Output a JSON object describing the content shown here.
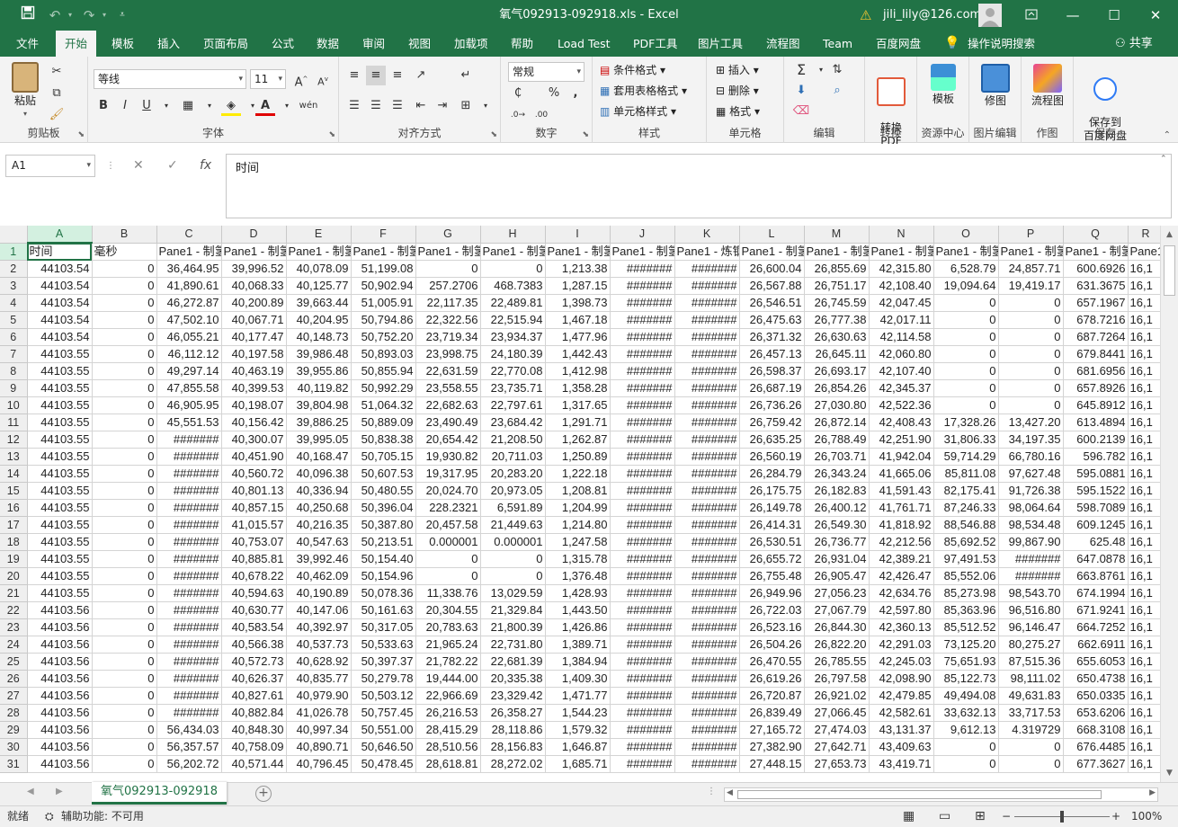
{
  "window": {
    "title": "氧气092913-092918.xls  -  Excel",
    "account": "jili_lily@126.com",
    "warning_icon": "warning-icon"
  },
  "qat": {
    "save": "save-icon",
    "undo": "undo-icon",
    "redo": "redo-icon",
    "customize": "customize-icon"
  },
  "tabs": [
    "文件",
    "开始",
    "模板",
    "插入",
    "页面布局",
    "公式",
    "数据",
    "审阅",
    "视图",
    "加载项",
    "帮助",
    "Load Test",
    "PDF工具",
    "图片工具",
    "流程图",
    "Team",
    "百度网盘"
  ],
  "active_tab": "开始",
  "tell_me": "操作说明搜索",
  "share": "共享",
  "ribbon": {
    "clipboard": {
      "label": "剪贴板",
      "paste": "粘贴"
    },
    "font": {
      "label": "字体",
      "name": "等线",
      "size": "11"
    },
    "align": {
      "label": "对齐方式"
    },
    "number": {
      "label": "数字",
      "format": "常规"
    },
    "styles": {
      "label": "样式",
      "conditional": "条件格式",
      "table": "套用表格格式",
      "cell": "单元格样式"
    },
    "cells": {
      "label": "单元格",
      "insert": "插入",
      "delete": "删除",
      "format": "格式"
    },
    "editing": {
      "label": "编辑"
    },
    "convert": {
      "label": "转换",
      "button": "转换\nPDF"
    },
    "resources": {
      "label": "资源中心",
      "button": "模板"
    },
    "image": {
      "label": "图片编辑",
      "button": "修图"
    },
    "draw": {
      "label": "作图",
      "button": "流程图"
    },
    "save": {
      "label": "保存",
      "button": "保存到\n百度网盘"
    }
  },
  "formula_bar": {
    "name_box": "A1",
    "content": "时间"
  },
  "grid": {
    "columns": [
      "A",
      "B",
      "C",
      "D",
      "E",
      "F",
      "G",
      "H",
      "I",
      "J",
      "K",
      "L",
      "M",
      "N",
      "O",
      "P",
      "Q",
      "R"
    ],
    "header_row": [
      "时间",
      "毫秒",
      "Pane1 - 制氢",
      "Pane1 - 制氢",
      "Pane1 - 制氢",
      "Pane1 - 制氢",
      "Pane1 - 制氢",
      "Pane1 - 制氢",
      "Pane1 - 制氢",
      "Pane1 - 制氢",
      "Pane1 - 炼钢",
      "Pane1 - 制氢",
      "Pane1 - 制氢",
      "Pane1 - 制氢",
      "Pane1 - 制氢",
      "Pane1 - 制氢",
      "Pane1 - 制氢",
      "Pane1"
    ],
    "rows": [
      [
        "44103.54",
        "0",
        "36,464.95",
        "39,996.52",
        "40,078.09",
        "51,199.08",
        "0",
        "0",
        "1,213.38",
        "#######",
        "#######",
        "26,600.04",
        "26,855.69",
        "42,315.80",
        "6,528.79",
        "24,857.71",
        "600.6926",
        "16,1"
      ],
      [
        "44103.54",
        "0",
        "41,890.61",
        "40,068.33",
        "40,125.77",
        "50,902.94",
        "257.2706",
        "468.7383",
        "1,287.15",
        "#######",
        "#######",
        "26,567.88",
        "26,751.17",
        "42,108.40",
        "19,094.64",
        "19,419.17",
        "631.3675",
        "16,1"
      ],
      [
        "44103.54",
        "0",
        "46,272.87",
        "40,200.89",
        "39,663.44",
        "51,005.91",
        "22,117.35",
        "22,489.81",
        "1,398.73",
        "#######",
        "#######",
        "26,546.51",
        "26,745.59",
        "42,047.45",
        "0",
        "0",
        "657.1967",
        "16,1"
      ],
      [
        "44103.54",
        "0",
        "47,502.10",
        "40,067.71",
        "40,204.95",
        "50,794.86",
        "22,322.56",
        "22,515.94",
        "1,467.18",
        "#######",
        "#######",
        "26,475.63",
        "26,777.38",
        "42,017.11",
        "0",
        "0",
        "678.7216",
        "16,1"
      ],
      [
        "44103.54",
        "0",
        "46,055.21",
        "40,177.47",
        "40,148.73",
        "50,752.20",
        "23,719.34",
        "23,934.37",
        "1,477.96",
        "#######",
        "#######",
        "26,371.32",
        "26,630.63",
        "42,114.58",
        "0",
        "0",
        "687.7264",
        "16,1"
      ],
      [
        "44103.55",
        "0",
        "46,112.12",
        "40,197.58",
        "39,986.48",
        "50,893.03",
        "23,998.75",
        "24,180.39",
        "1,442.43",
        "#######",
        "#######",
        "26,457.13",
        "26,645.11",
        "42,060.80",
        "0",
        "0",
        "679.8441",
        "16,1"
      ],
      [
        "44103.55",
        "0",
        "49,297.14",
        "40,463.19",
        "39,955.86",
        "50,855.94",
        "22,631.59",
        "22,770.08",
        "1,412.98",
        "#######",
        "#######",
        "26,598.37",
        "26,693.17",
        "42,107.40",
        "0",
        "0",
        "681.6956",
        "16,1"
      ],
      [
        "44103.55",
        "0",
        "47,855.58",
        "40,399.53",
        "40,119.82",
        "50,992.29",
        "23,558.55",
        "23,735.71",
        "1,358.28",
        "#######",
        "#######",
        "26,687.19",
        "26,854.26",
        "42,345.37",
        "0",
        "0",
        "657.8926",
        "16,1"
      ],
      [
        "44103.55",
        "0",
        "46,905.95",
        "40,198.07",
        "39,804.98",
        "51,064.32",
        "22,682.63",
        "22,797.61",
        "1,317.65",
        "#######",
        "#######",
        "26,736.26",
        "27,030.80",
        "42,522.36",
        "0",
        "0",
        "645.8912",
        "16,1"
      ],
      [
        "44103.55",
        "0",
        "45,551.53",
        "40,156.42",
        "39,886.25",
        "50,889.09",
        "23,490.49",
        "23,684.42",
        "1,291.71",
        "#######",
        "#######",
        "26,759.42",
        "26,872.14",
        "42,408.43",
        "17,328.26",
        "13,427.20",
        "613.4894",
        "16,1"
      ],
      [
        "44103.55",
        "0",
        "#######",
        "40,300.07",
        "39,995.05",
        "50,838.38",
        "20,654.42",
        "21,208.50",
        "1,262.87",
        "#######",
        "#######",
        "26,635.25",
        "26,788.49",
        "42,251.90",
        "31,806.33",
        "34,197.35",
        "600.2139",
        "16,1"
      ],
      [
        "44103.55",
        "0",
        "#######",
        "40,451.90",
        "40,168.47",
        "50,705.15",
        "19,930.82",
        "20,711.03",
        "1,250.89",
        "#######",
        "#######",
        "26,560.19",
        "26,703.71",
        "41,942.04",
        "59,714.29",
        "66,780.16",
        "596.782",
        "16,1"
      ],
      [
        "44103.55",
        "0",
        "#######",
        "40,560.72",
        "40,096.38",
        "50,607.53",
        "19,317.95",
        "20,283.20",
        "1,222.18",
        "#######",
        "#######",
        "26,284.79",
        "26,343.24",
        "41,665.06",
        "85,811.08",
        "97,627.48",
        "595.0881",
        "16,1"
      ],
      [
        "44103.55",
        "0",
        "#######",
        "40,801.13",
        "40,336.94",
        "50,480.55",
        "20,024.70",
        "20,973.05",
        "1,208.81",
        "#######",
        "#######",
        "26,175.75",
        "26,182.83",
        "41,591.43",
        "82,175.41",
        "91,726.38",
        "595.1522",
        "16,1"
      ],
      [
        "44103.55",
        "0",
        "#######",
        "40,857.15",
        "40,250.68",
        "50,396.04",
        "228.2321",
        "6,591.89",
        "1,204.99",
        "#######",
        "#######",
        "26,149.78",
        "26,400.12",
        "41,761.71",
        "87,246.33",
        "98,064.64",
        "598.7089",
        "16,1"
      ],
      [
        "44103.55",
        "0",
        "#######",
        "41,015.57",
        "40,216.35",
        "50,387.80",
        "20,457.58",
        "21,449.63",
        "1,214.80",
        "#######",
        "#######",
        "26,414.31",
        "26,549.30",
        "41,818.92",
        "88,546.88",
        "98,534.48",
        "609.1245",
        "16,1"
      ],
      [
        "44103.55",
        "0",
        "#######",
        "40,753.07",
        "40,547.63",
        "50,213.51",
        "0.000001",
        "0.000001",
        "1,247.58",
        "#######",
        "#######",
        "26,530.51",
        "26,736.77",
        "42,212.56",
        "85,692.52",
        "99,867.90",
        "625.48",
        "16,1"
      ],
      [
        "44103.55",
        "0",
        "#######",
        "40,885.81",
        "39,992.46",
        "50,154.40",
        "0",
        "0",
        "1,315.78",
        "#######",
        "#######",
        "26,655.72",
        "26,931.04",
        "42,389.21",
        "97,491.53",
        "#######",
        "647.0878",
        "16,1"
      ],
      [
        "44103.55",
        "0",
        "#######",
        "40,678.22",
        "40,462.09",
        "50,154.96",
        "0",
        "0",
        "1,376.48",
        "#######",
        "#######",
        "26,755.48",
        "26,905.47",
        "42,426.47",
        "85,552.06",
        "#######",
        "663.8761",
        "16,1"
      ],
      [
        "44103.55",
        "0",
        "#######",
        "40,594.63",
        "40,190.89",
        "50,078.36",
        "11,338.76",
        "13,029.59",
        "1,428.93",
        "#######",
        "#######",
        "26,949.96",
        "27,056.23",
        "42,634.76",
        "85,273.98",
        "98,543.70",
        "674.1994",
        "16,1"
      ],
      [
        "44103.56",
        "0",
        "#######",
        "40,630.77",
        "40,147.06",
        "50,161.63",
        "20,304.55",
        "21,329.84",
        "1,443.50",
        "#######",
        "#######",
        "26,722.03",
        "27,067.79",
        "42,597.80",
        "85,363.96",
        "96,516.80",
        "671.9241",
        "16,1"
      ],
      [
        "44103.56",
        "0",
        "#######",
        "40,583.54",
        "40,392.97",
        "50,317.05",
        "20,783.63",
        "21,800.39",
        "1,426.86",
        "#######",
        "#######",
        "26,523.16",
        "26,844.30",
        "42,360.13",
        "85,512.52",
        "96,146.47",
        "664.7252",
        "16,1"
      ],
      [
        "44103.56",
        "0",
        "#######",
        "40,566.38",
        "40,537.73",
        "50,533.63",
        "21,965.24",
        "22,731.80",
        "1,389.71",
        "#######",
        "#######",
        "26,504.26",
        "26,822.20",
        "42,291.03",
        "73,125.20",
        "80,275.27",
        "662.6911",
        "16,1"
      ],
      [
        "44103.56",
        "0",
        "#######",
        "40,572.73",
        "40,628.92",
        "50,397.37",
        "21,782.22",
        "22,681.39",
        "1,384.94",
        "#######",
        "#######",
        "26,470.55",
        "26,785.55",
        "42,245.03",
        "75,651.93",
        "87,515.36",
        "655.6053",
        "16,1"
      ],
      [
        "44103.56",
        "0",
        "#######",
        "40,626.37",
        "40,835.77",
        "50,279.78",
        "19,444.00",
        "20,335.38",
        "1,409.30",
        "#######",
        "#######",
        "26,619.26",
        "26,797.58",
        "42,098.90",
        "85,122.73",
        "98,111.02",
        "650.4738",
        "16,1"
      ],
      [
        "44103.56",
        "0",
        "#######",
        "40,827.61",
        "40,979.90",
        "50,503.12",
        "22,966.69",
        "23,329.42",
        "1,471.77",
        "#######",
        "#######",
        "26,720.87",
        "26,921.02",
        "42,479.85",
        "49,494.08",
        "49,631.83",
        "650.0335",
        "16,1"
      ],
      [
        "44103.56",
        "0",
        "#######",
        "40,882.84",
        "41,026.78",
        "50,757.45",
        "26,216.53",
        "26,358.27",
        "1,544.23",
        "#######",
        "#######",
        "26,839.49",
        "27,066.45",
        "42,582.61",
        "33,632.13",
        "33,717.53",
        "653.6206",
        "16,1"
      ],
      [
        "44103.56",
        "0",
        "56,434.03",
        "40,848.30",
        "40,997.34",
        "50,551.00",
        "28,415.29",
        "28,118.86",
        "1,579.32",
        "#######",
        "#######",
        "27,165.72",
        "27,474.03",
        "43,131.37",
        "9,612.13",
        "4.319729",
        "668.3108",
        "16,1"
      ],
      [
        "44103.56",
        "0",
        "56,357.57",
        "40,758.09",
        "40,890.71",
        "50,646.50",
        "28,510.56",
        "28,156.83",
        "1,646.87",
        "#######",
        "#######",
        "27,382.90",
        "27,642.71",
        "43,409.63",
        "0",
        "0",
        "676.4485",
        "16,1"
      ],
      [
        "44103.56",
        "0",
        "56,202.72",
        "40,571.44",
        "40,796.45",
        "50,478.45",
        "28,618.81",
        "28,272.02",
        "1,685.71",
        "#######",
        "#######",
        "27,448.15",
        "27,653.73",
        "43,419.71",
        "0",
        "0",
        "677.3627",
        "16,1"
      ]
    ]
  },
  "sheet_tab": "氧气092913-092918",
  "status": {
    "ready": "就绪",
    "accessibility": "辅助功能: 不可用",
    "zoom": "100%"
  }
}
